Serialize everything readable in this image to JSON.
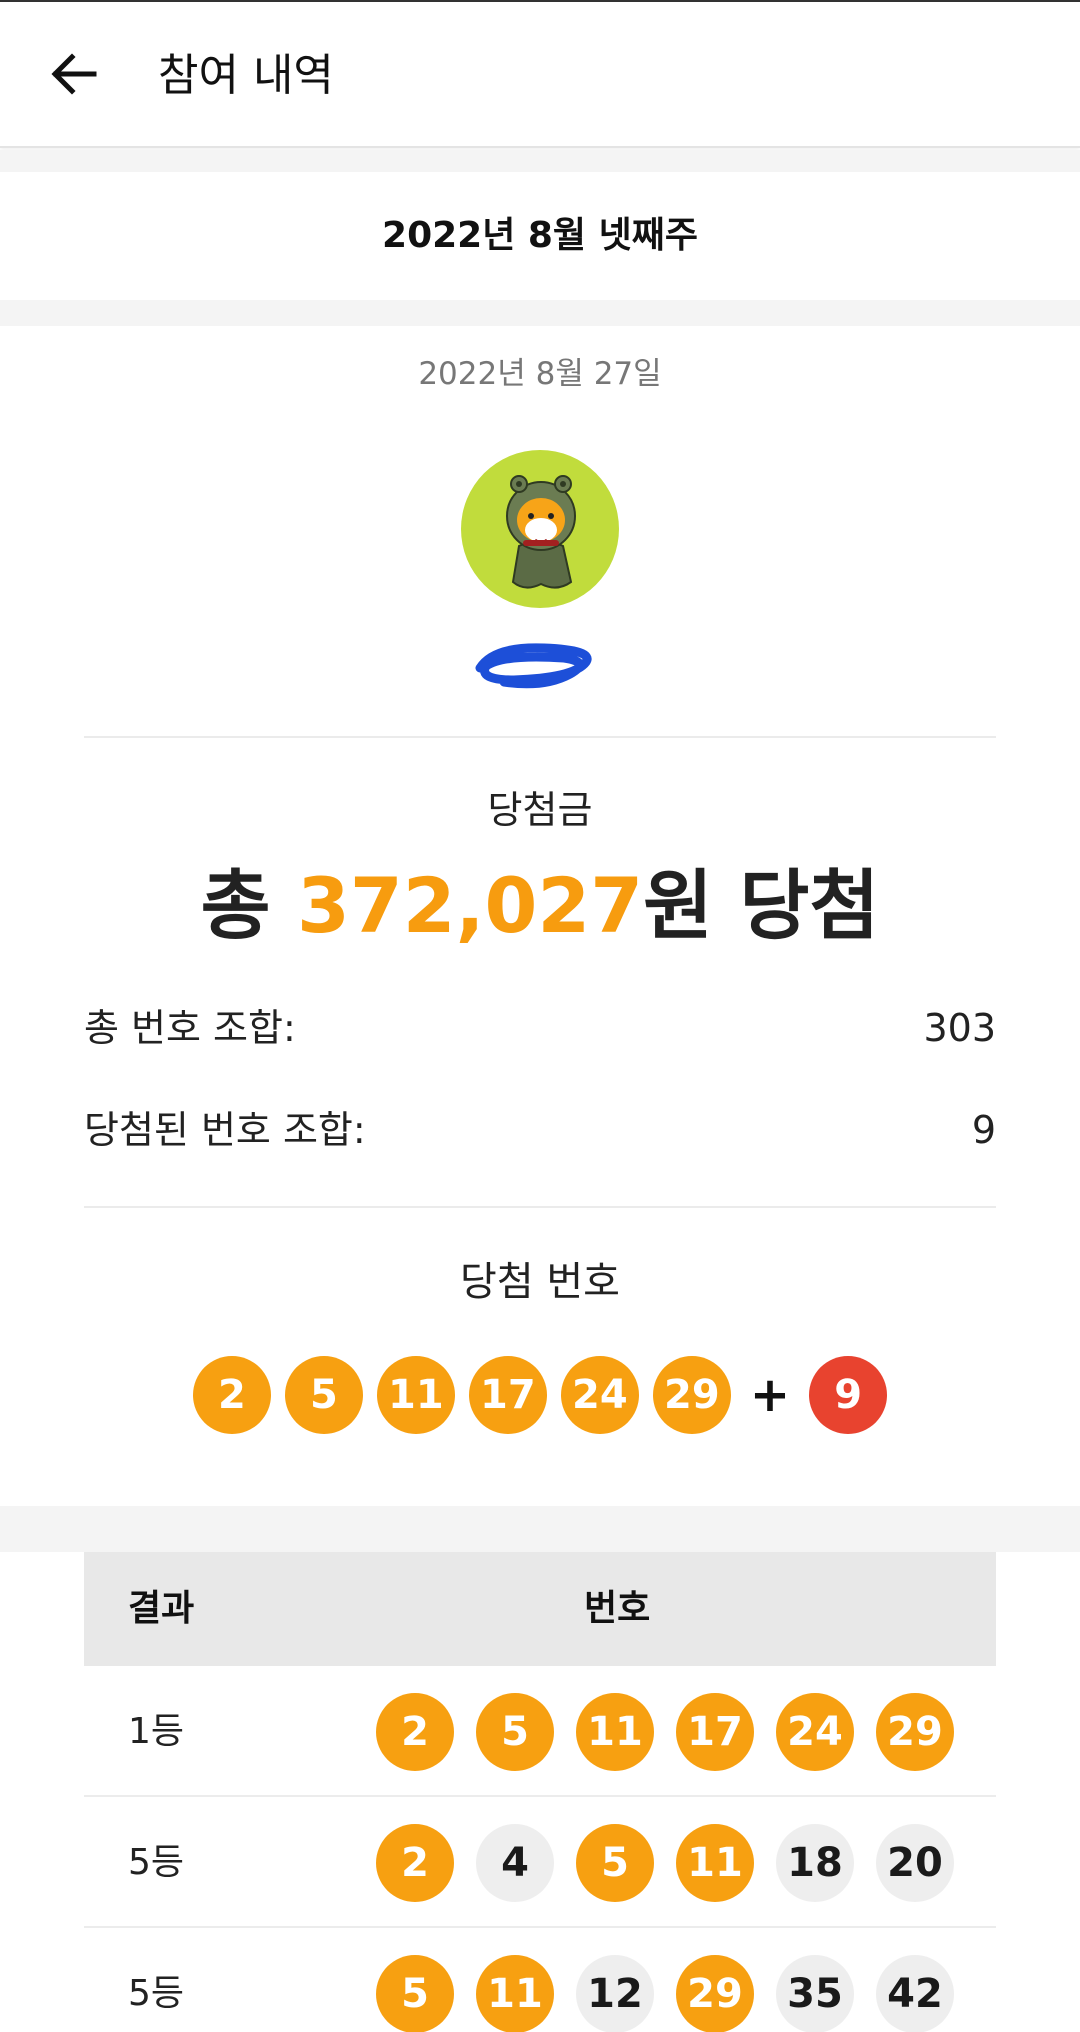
{
  "appbar": {
    "title": "참여 내역",
    "back_icon": "arrow-left-icon"
  },
  "week_title": "2022년 8월 넷째주",
  "draw_date": "2022년 8월 27일",
  "prize": {
    "label": "당첨금",
    "prefix": "총",
    "amount": "372,027",
    "suffix": "원 당첨",
    "accent_color": "#f79c0f"
  },
  "stats": {
    "total_label": "총 번호 조합:",
    "total_value": "303",
    "won_label": "당첨된 번호 조합:",
    "won_value": "9"
  },
  "winning": {
    "label": "당첨 번호",
    "numbers": [
      "2",
      "5",
      "11",
      "17",
      "24",
      "29"
    ],
    "plus": "+",
    "bonus": "9"
  },
  "table": {
    "col_result": "결과",
    "col_numbers": "번호",
    "rows": [
      {
        "rank": "1등",
        "numbers": [
          {
            "n": "2",
            "hit": true
          },
          {
            "n": "5",
            "hit": true
          },
          {
            "n": "11",
            "hit": true
          },
          {
            "n": "17",
            "hit": true
          },
          {
            "n": "24",
            "hit": true
          },
          {
            "n": "29",
            "hit": true
          }
        ]
      },
      {
        "rank": "5등",
        "numbers": [
          {
            "n": "2",
            "hit": true
          },
          {
            "n": "4",
            "hit": false
          },
          {
            "n": "5",
            "hit": true
          },
          {
            "n": "11",
            "hit": true
          },
          {
            "n": "18",
            "hit": false
          },
          {
            "n": "20",
            "hit": false
          }
        ]
      },
      {
        "rank": "5등",
        "numbers": [
          {
            "n": "5",
            "hit": true
          },
          {
            "n": "11",
            "hit": true
          },
          {
            "n": "12",
            "hit": false
          },
          {
            "n": "29",
            "hit": true
          },
          {
            "n": "35",
            "hit": false
          },
          {
            "n": "42",
            "hit": false
          }
        ]
      }
    ]
  },
  "colors": {
    "hit": "#f7a011",
    "miss": "#eeeeee",
    "bonus": "#e8432f",
    "avatar_bg": "#c1dc3c"
  }
}
